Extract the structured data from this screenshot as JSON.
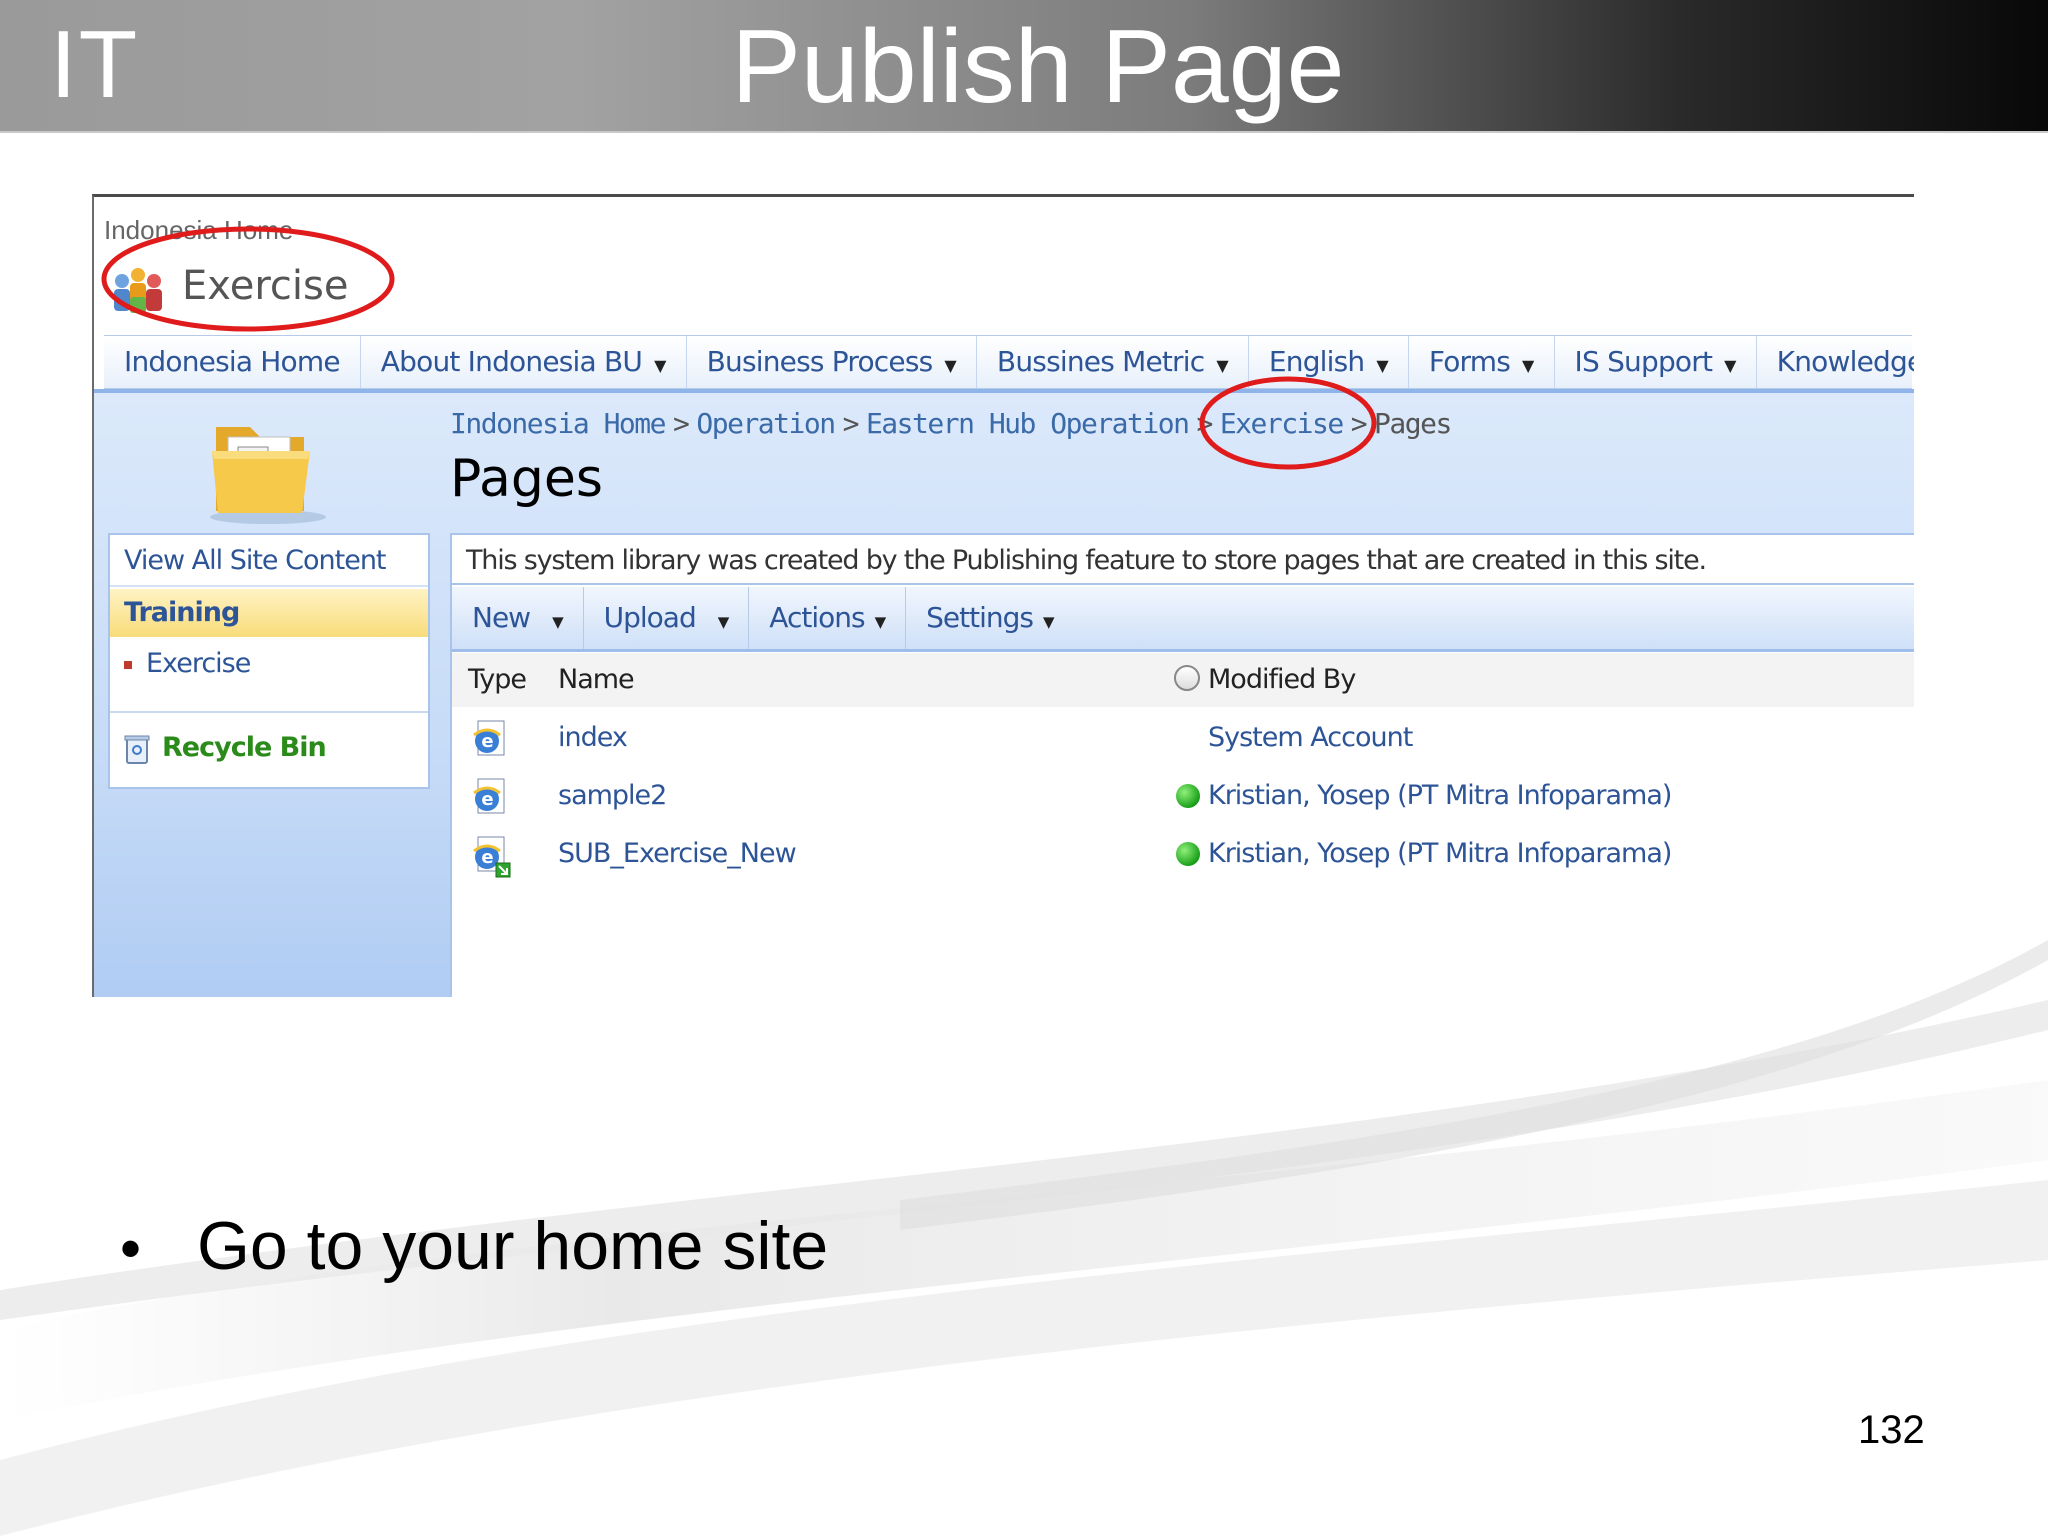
{
  "slide": {
    "logo": "IT",
    "title": "Publish Page",
    "bullet": "Go to your home site",
    "page_number": "132",
    "annotation_color": "#e01b1b"
  },
  "site": {
    "top_crumb": "Indonesia Home",
    "title": "Exercise",
    "logo_icon": "people-group-icon"
  },
  "topnav": [
    {
      "label": "Indonesia Home",
      "dropdown": false
    },
    {
      "label": "About Indonesia BU",
      "dropdown": true
    },
    {
      "label": "Business Process",
      "dropdown": true
    },
    {
      "label": "Bussines Metric",
      "dropdown": true
    },
    {
      "label": "English",
      "dropdown": true
    },
    {
      "label": "Forms",
      "dropdown": true
    },
    {
      "label": "IS Support",
      "dropdown": true
    },
    {
      "label": "Knowledge Sharing",
      "dropdown": true
    }
  ],
  "breadcrumb": {
    "items": [
      "Indonesia Home",
      "Operation",
      "Eastern Hub Operation",
      "Exercise",
      "Pages"
    ],
    "separator": ">"
  },
  "page": {
    "title": "Pages",
    "description": "This system library was created by the Publishing feature to store pages that are created in this site."
  },
  "leftnav": {
    "view_all": "View All Site Content",
    "section": "Training",
    "sub_item": "Exercise",
    "recycle": "Recycle Bin"
  },
  "toolbar": {
    "items": [
      {
        "label": "New",
        "dropdown": true
      },
      {
        "label": "Upload",
        "dropdown": true
      },
      {
        "label": "Actions",
        "dropdown": true
      },
      {
        "label": "Settings",
        "dropdown": true
      }
    ]
  },
  "table": {
    "columns": {
      "type": "Type",
      "name": "Name",
      "modified_by": "Modified By"
    },
    "rows": [
      {
        "name": "index",
        "modified_by": "System Account",
        "status": "none",
        "icon": "ie-page-icon"
      },
      {
        "name": "sample2",
        "modified_by": "Kristian, Yosep (PT Mitra Infoparama)",
        "status": "online",
        "icon": "ie-page-icon"
      },
      {
        "name": "SUB_Exercise_New",
        "modified_by": "Kristian, Yosep (PT Mitra Infoparama)",
        "status": "online",
        "icon": "ie-page-checkout-icon"
      }
    ]
  }
}
